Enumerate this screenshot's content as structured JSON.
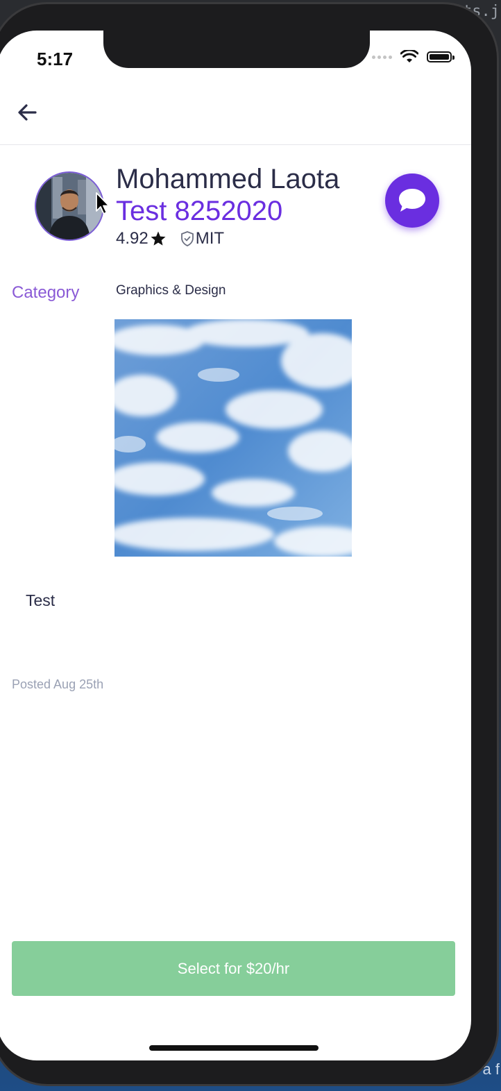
{
  "background": {
    "top_text": "sts.j",
    "bottom_text": "a f"
  },
  "status_bar": {
    "time": "5:17"
  },
  "profile": {
    "name": "Mohammed Laota",
    "job_title": "Test 8252020",
    "rating": "4.92",
    "school": "MIT"
  },
  "details": {
    "category_label": "Category",
    "category_value": "Graphics & Design",
    "description": "Test",
    "posted": "Posted Aug 25th"
  },
  "action": {
    "select_label": "Select for $20/hr"
  },
  "colors": {
    "accent_purple": "#6a2ee0",
    "category_purple": "#8a5ad6",
    "button_green": "#86ce9a",
    "text_dark": "#2b2d48"
  }
}
